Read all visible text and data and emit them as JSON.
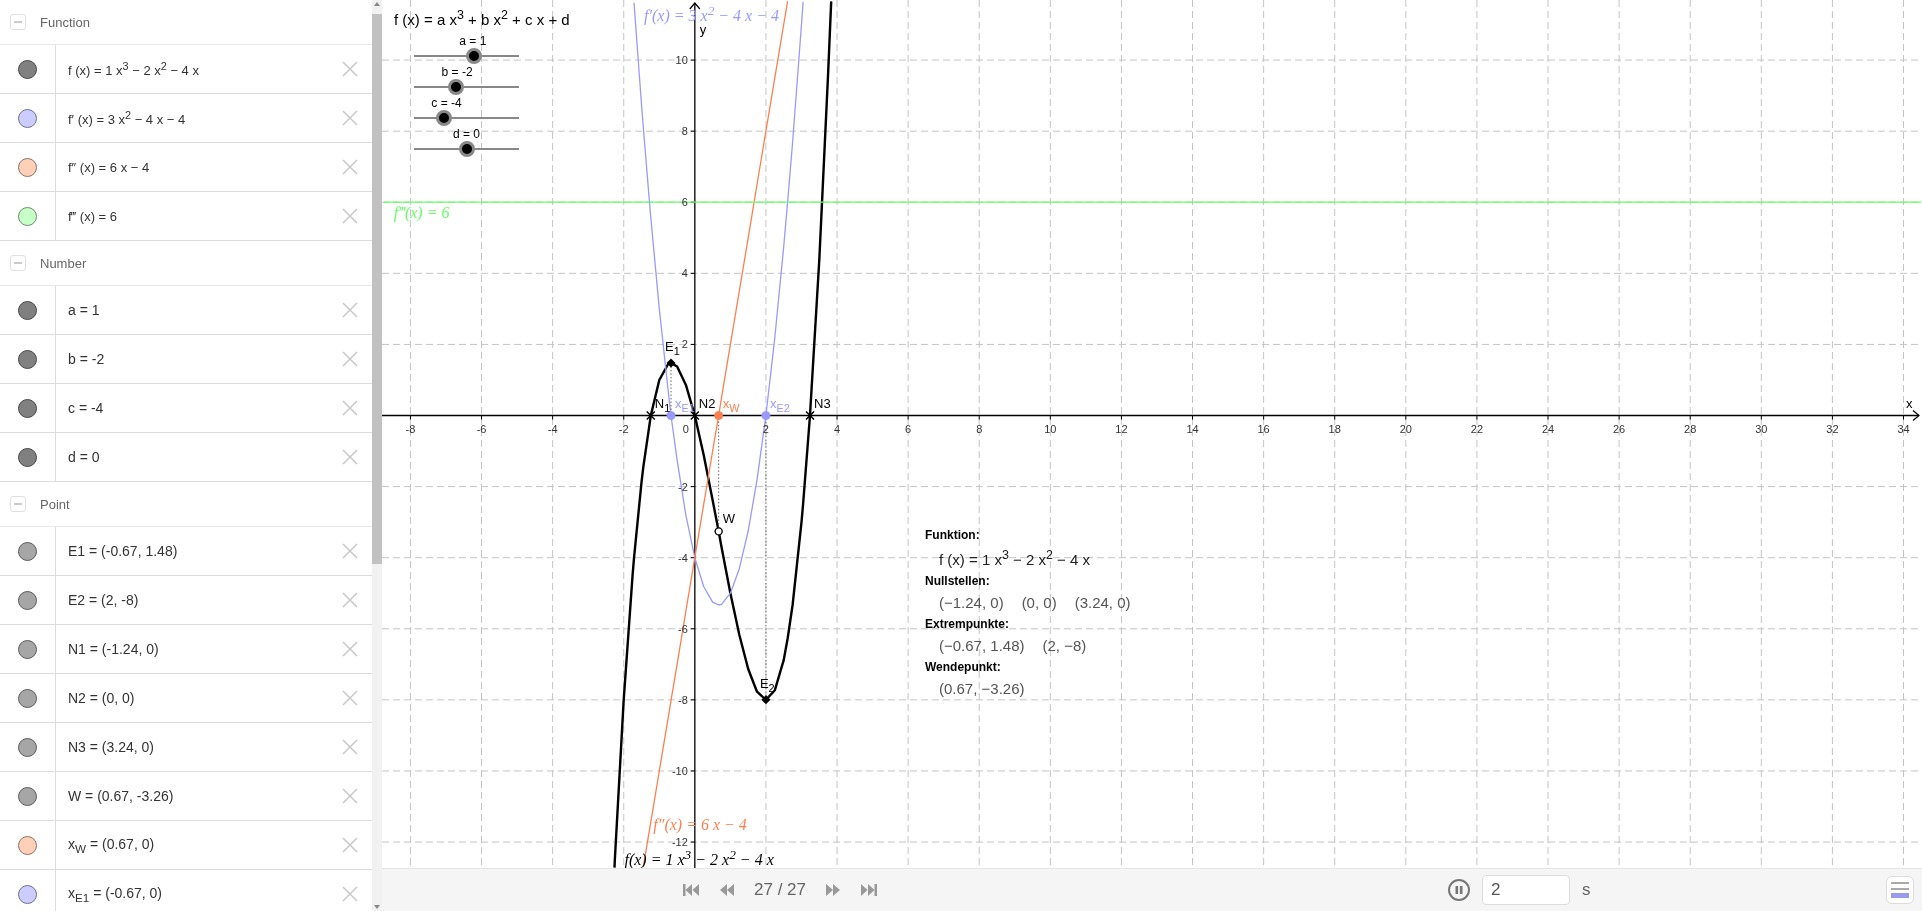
{
  "algebra_view": {
    "groups": [
      {
        "title": "Function",
        "expanded": true,
        "items": [
          {
            "text": "f (x) = 1 x$^{3}$ − 2 x$^{2}$ − 4 x",
            "color": "#808080"
          },
          {
            "text": "f′ (x) = 3 x$^{2}$ − 4 x − 4",
            "color": "#ccccff"
          },
          {
            "text": "f″ (x) = 6 x − 4",
            "color": "#ffd0b8"
          },
          {
            "text": "f‴ (x) = 6",
            "color": "#c8ffc8"
          }
        ]
      },
      {
        "title": "Number",
        "expanded": true,
        "items": [
          {
            "text": "a = 1",
            "color": "#808080"
          },
          {
            "text": "b = -2",
            "color": "#808080"
          },
          {
            "text": "c = -4",
            "color": "#808080"
          },
          {
            "text": "d = 0",
            "color": "#808080"
          }
        ]
      },
      {
        "title": "Point",
        "expanded": true,
        "items": [
          {
            "text": "E1 = (-0.67, 1.48)",
            "color": "#a6a6a6"
          },
          {
            "text": "E2 = (2, -8)",
            "color": "#a6a6a6"
          },
          {
            "text": "N1 = (-1.24, 0)",
            "color": "#a6a6a6"
          },
          {
            "text": "N2 = (0, 0)",
            "color": "#a6a6a6"
          },
          {
            "text": "N3 = (3.24, 0)",
            "color": "#a6a6a6"
          },
          {
            "text": "W = (0.67, -3.26)",
            "color": "#a6a6a6"
          },
          {
            "text": "x$_{W}$ = (0.67, 0)",
            "color": "#ffd0b8"
          },
          {
            "text": "x$_{E1}$ = (-0.67, 0)",
            "color": "#ccccff"
          }
        ]
      }
    ]
  },
  "graphics_view": {
    "formula": "f (x) = a x$^{3}$ + b x$^{2}$ + c x + d",
    "sliders": [
      {
        "label": "a = 1",
        "level": 0.56
      },
      {
        "label": "b = -2",
        "level": 0.41
      },
      {
        "label": "c = -4",
        "level": 0.31
      },
      {
        "label": "d = 0",
        "level": 0.5
      }
    ],
    "chart_data": {
      "type": "line",
      "xlabel": "x",
      "ylabel": "y",
      "grid": true,
      "x": [
        -8.75,
        -2.26,
        -2.25,
        -2,
        -1.75,
        -1.71,
        -1.5,
        -1.45,
        -1.25,
        -1.24,
        -1,
        -0.75,
        -0.67,
        -0.5,
        -0.25,
        0,
        0.25,
        0.5,
        0.67,
        0.75,
        1,
        1.25,
        1.5,
        1.75,
        2,
        2.25,
        2.5,
        2.61,
        2.75,
        3,
        3.045,
        3.24,
        3.25,
        3.5,
        3.75,
        3.835,
        34.5
      ],
      "series": [
        {
          "color": "#000000",
          "values": [
            null,
            -12.72,
            -12.52,
            -8,
            -4.48,
            -4.01,
            -1.88,
            -1.45,
            -0.08,
            0,
            1,
            1.45,
            1.48,
            1.38,
            0.86,
            0,
            -1.11,
            -2.38,
            -3.26,
            -3.7,
            -5,
            -6.17,
            -7.13,
            -7.77,
            -8,
            -7.73,
            -6.88,
            -6.28,
            -5.33,
            -3,
            -2.49,
            0,
            0.2,
            4.38,
            9.61,
            11.65,
            null
          ]
        },
        {
          "color": "#9999ff",
          "values": [
            null,
            null,
            null,
            null,
            null,
            11.61,
            8.75,
            8.11,
            5.69,
            5.57,
            3,
            0.69,
            0,
            -1.25,
            -2.81,
            -4,
            -4.81,
            -5.25,
            -5.33,
            -5.31,
            -5,
            -4.31,
            -3.25,
            -1.81,
            0,
            2.19,
            4.75,
            6,
            7.69,
            11,
            11.64,
            null,
            null,
            null,
            null,
            null,
            null
          ]
        },
        {
          "color": "#ff7f50",
          "values": [
            null,
            null,
            null,
            null,
            null,
            null,
            null,
            -12.7,
            -11.5,
            -11.44,
            -10,
            -8.5,
            -8.02,
            -7,
            -5.5,
            -4,
            -2.5,
            -1,
            0,
            0.5,
            2,
            3.5,
            5,
            6.5,
            8,
            9.5,
            11,
            11.66,
            null,
            null,
            null,
            null,
            null,
            null,
            null,
            null,
            null
          ]
        },
        {
          "color": "#66ff66",
          "values": [
            6,
            6,
            6,
            6,
            6,
            6,
            6,
            6,
            6,
            6,
            6,
            6,
            6,
            6,
            6,
            6,
            6,
            6,
            6,
            6,
            6,
            6,
            6,
            6,
            6,
            6,
            6,
            6,
            6,
            6,
            6,
            6,
            6,
            6,
            6,
            6,
            6
          ]
        }
      ],
      "xlim": [
        -8.8,
        34.52
      ],
      "ylim": [
        -12.73,
        11.69
      ],
      "xticks": [
        -8,
        -6,
        -4,
        -2,
        0,
        2,
        4,
        6,
        8,
        10,
        12,
        14,
        16,
        18,
        20,
        22,
        24,
        26,
        28,
        30,
        32,
        34
      ],
      "yticks": [
        -12,
        -10,
        -8,
        -6,
        -4,
        -2,
        2,
        4,
        6,
        8,
        10
      ],
      "annotations": [
        {
          "text": "N$_{1}$",
          "x": -1.24,
          "y": 0
        },
        {
          "text": "N2",
          "x": 0,
          "y": 0
        },
        {
          "text": "N3",
          "x": 3.24,
          "y": 0
        },
        {
          "text": "E$_{1}$",
          "x": -0.67,
          "y": 1.48
        },
        {
          "text": "E$_{2}$",
          "x": 2,
          "y": -8
        },
        {
          "text": "W",
          "x": 0.67,
          "y": -3.26
        },
        {
          "text": "x$_{E1}$",
          "x": -0.67,
          "y": 0
        },
        {
          "text": "x$_{W}$",
          "x": 0.67,
          "y": 0
        },
        {
          "text": "x$_{E2}$",
          "x": 2,
          "y": 0
        },
        "f(x) = 1 x$^{3}$ − 2 x$^{2}$ − 4 x",
        "f′(x) = 3 x$^{2}$ − 4 x − 4",
        "f″(x) = 6 x − 4",
        "f‴(x) = 6"
      ]
    },
    "info_text": [
      {
        "kind": "heading",
        "text": "Funktion:"
      },
      {
        "kind": "formula",
        "items": [
          "f (x) = 1 x$^{3}$ − 2 x$^{2}$ − 4 x"
        ]
      },
      {
        "kind": "heading",
        "text": "Nullstellen:"
      },
      {
        "kind": "values",
        "items": [
          "(−1.24, 0)",
          "(0, 0)",
          "(3.24, 0)"
        ]
      },
      {
        "kind": "heading",
        "text": "Extrempunkte:"
      },
      {
        "kind": "values",
        "items": [
          "(−0.67, 1.48)",
          "(2, −8)"
        ]
      },
      {
        "kind": "heading",
        "text": "Wendepunkt:"
      },
      {
        "kind": "values",
        "items": [
          "(0.67, −3.26)"
        ]
      }
    ]
  },
  "animation_bar": {
    "counter": "27 / 27",
    "playing": true,
    "speed": "2",
    "unit": "s"
  }
}
